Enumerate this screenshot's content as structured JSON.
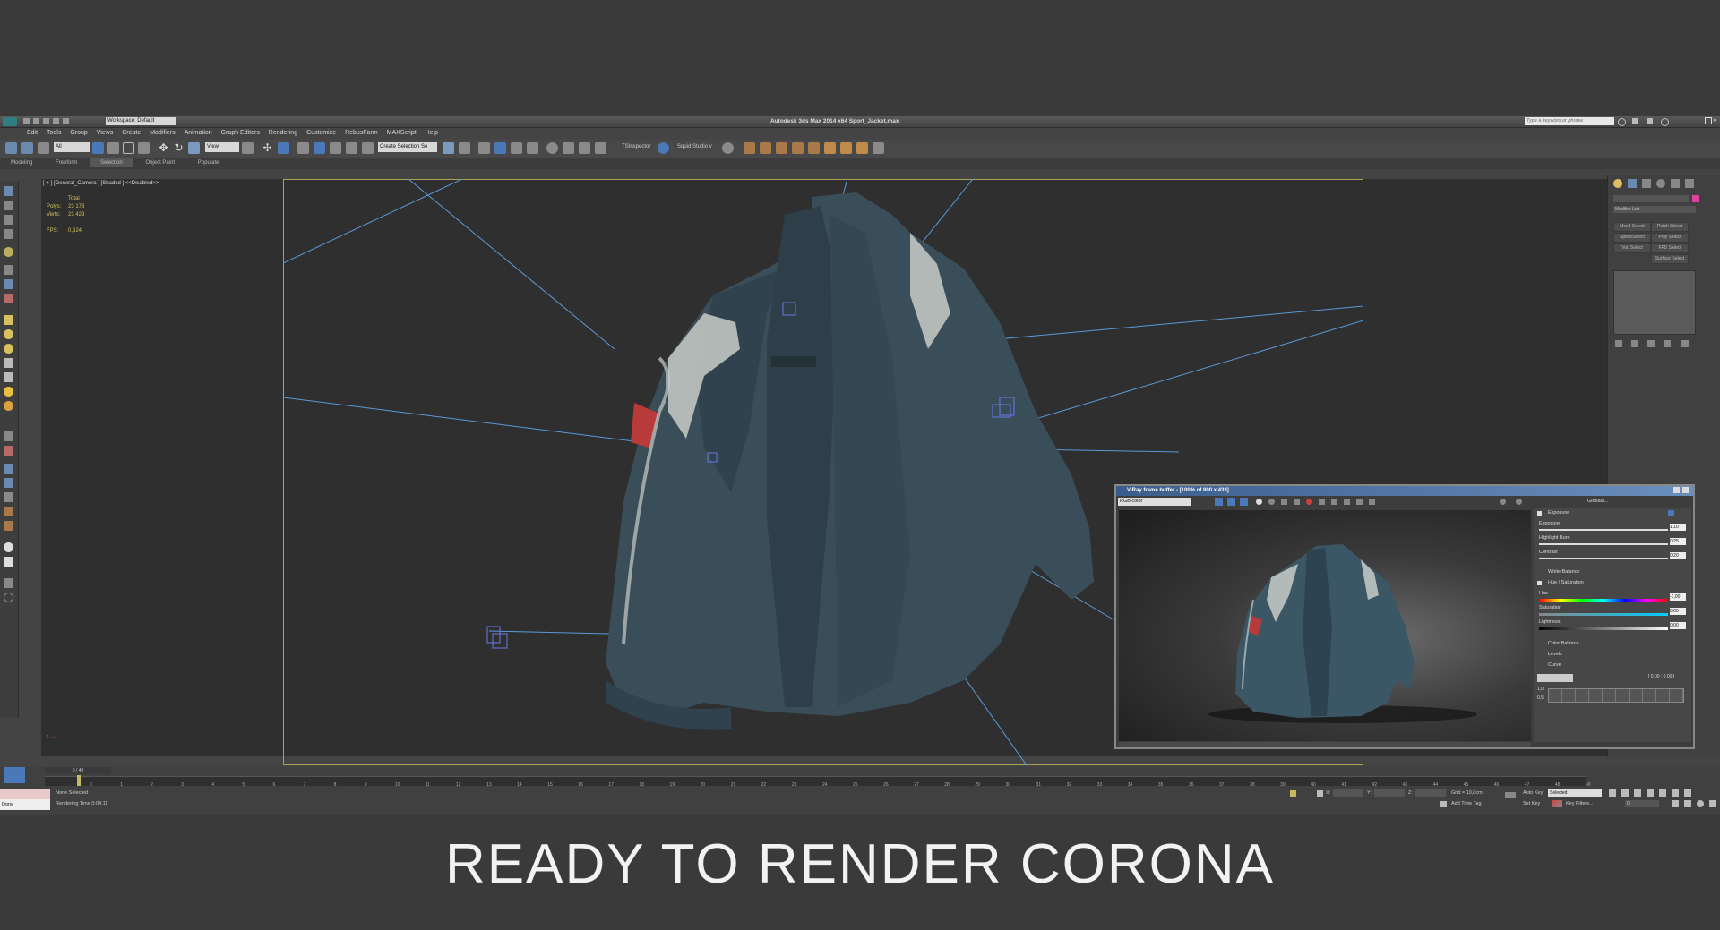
{
  "app": {
    "title": "Autodesk 3ds Max  2014 x64    Sport_Jacket.max",
    "workspace": "Workspace: Default",
    "search_placeholder": "Type a keyword or phrase"
  },
  "menu": [
    "Edit",
    "Tools",
    "Group",
    "Views",
    "Create",
    "Modifiers",
    "Animation",
    "Graph Editors",
    "Rendering",
    "Customize",
    "RebusFarm",
    "MAXScript",
    "Help"
  ],
  "toolbar": {
    "selection_filter": "All",
    "view_select": "View",
    "named_selection": "Create Selection Se",
    "plugin1": "TSInspector",
    "plugin2": "Squid Studio v"
  },
  "ribbon_tabs": [
    "Modeling",
    "Freeform",
    "Selection",
    "Object Paint",
    "Populate"
  ],
  "ribbon_active": "Selection",
  "viewport": {
    "label": "[ + ] [General_Camera ] [Shaded ]  <<Disabled>>",
    "stats_total": "Total",
    "polys_label": "Polys:",
    "polys_value": "23 178",
    "verts_label": "Verts:",
    "verts_value": "23 429",
    "fps_label": "FPS:",
    "fps_value": "0,324"
  },
  "command_panel": {
    "modifier_list": "Modifier List",
    "buttons": [
      "Mesh Select",
      "Patch Select",
      "SplineSelect",
      "Poly Select",
      "Vol. Select",
      "FFD Select",
      "Surface Select"
    ]
  },
  "vfb": {
    "title": "V-Ray frame buffer - [100% of 800 x 433]",
    "channel": "RGB color",
    "globals": "Globals...",
    "exposure_header": "Exposure",
    "exposure_label": "Exposure",
    "exposure_value": "1,10",
    "highlight_label": "Highlight Burn",
    "highlight_value": "0,25",
    "contrast_label": "Contrast",
    "contrast_value": "0,20",
    "white_balance": "White Balance",
    "hue_sat": "Hue / Saturation",
    "hue_label": "Hue",
    "hue_value": "-1,00",
    "saturation_label": "Saturation",
    "saturation_value": "0,00",
    "lightness_label": "Lightness",
    "lightness_value": "0,00",
    "color_balance": "Color Balance",
    "levels": "Levels",
    "curve": "Curve",
    "curve_coords": "[ 0,00 ; 0,00 ]",
    "curve_y1": "1,0",
    "curve_y2": "0,5"
  },
  "timeline": {
    "frame_counter": "0 / 40",
    "ticks": [
      "0",
      "1",
      "2",
      "3",
      "4",
      "5",
      "6",
      "7",
      "8",
      "9",
      "10",
      "11",
      "12",
      "13",
      "14",
      "15",
      "16",
      "17",
      "18",
      "19",
      "20",
      "21",
      "22",
      "23",
      "24",
      "25",
      "26",
      "27",
      "28",
      "29",
      "30",
      "31",
      "32",
      "33",
      "34",
      "35",
      "36",
      "37",
      "38",
      "39",
      "40",
      "41",
      "42",
      "43",
      "44",
      "45",
      "46",
      "47",
      "48",
      "49"
    ]
  },
  "status": {
    "maxscript_text": "Done",
    "selection": "None Selected",
    "render_time": "Rendering Time  0:04:11",
    "x_label": "X:",
    "y_label": "Y:",
    "z_label": "Z:",
    "grid": "Grid = 10,0cm",
    "add_time_tag": "Add Time Tag",
    "auto_key": "Auto Key",
    "auto_key_value": "Selected",
    "set_key": "Set Key",
    "key_filters": "Key Filters...",
    "frame_value": "0"
  },
  "caption": "READY TO RENDER CORONA",
  "colors": {
    "accent": "#3e6ea8",
    "safe_frame": "#aaa35a",
    "jacket": "#3a4e5a",
    "patch": "#b83a3a"
  }
}
